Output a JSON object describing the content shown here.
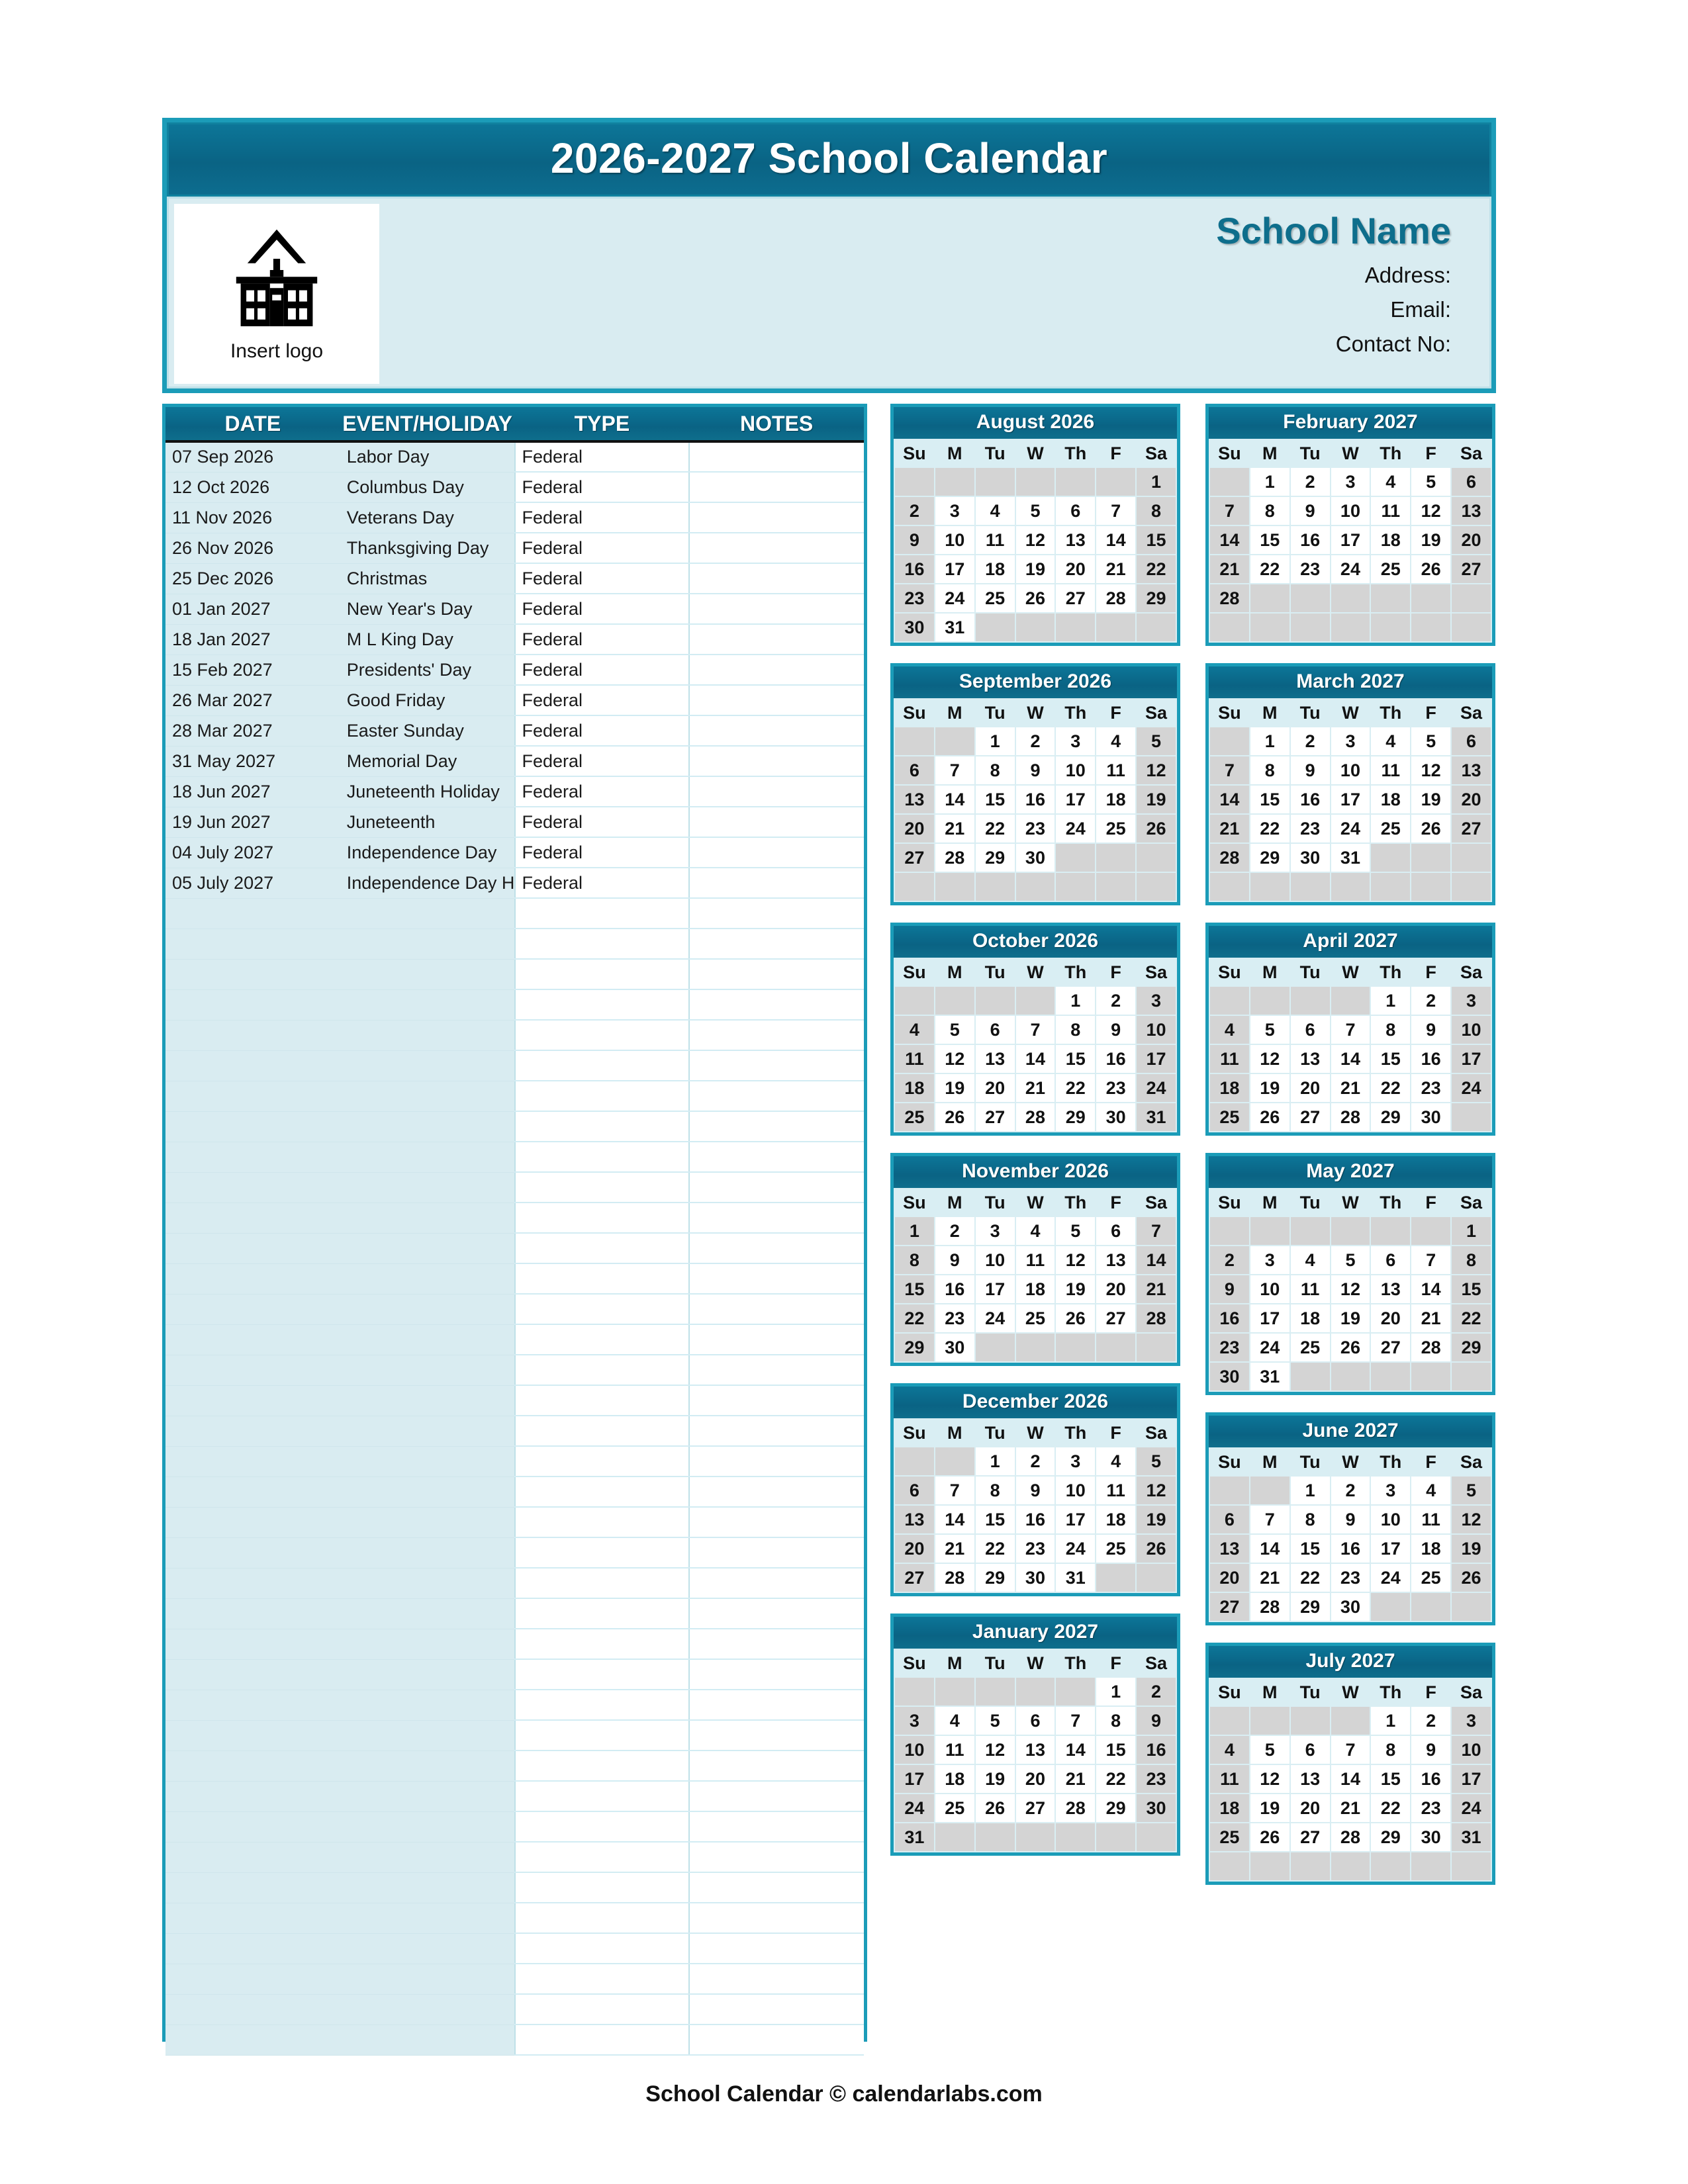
{
  "header": {
    "title": "2026-2027 School Calendar",
    "logo_caption": "Insert logo",
    "school_name": "School Name",
    "address_label": "Address:",
    "email_label": "Email:",
    "contact_label": "Contact No:"
  },
  "events_table": {
    "columns": [
      "DATE",
      "EVENT/HOLIDAY",
      "TYPE",
      "NOTES"
    ],
    "rows": [
      {
        "date": "07 Sep 2026",
        "event": "Labor Day",
        "type": "Federal",
        "notes": ""
      },
      {
        "date": "12 Oct 2026",
        "event": "Columbus Day",
        "type": "Federal",
        "notes": ""
      },
      {
        "date": "11 Nov 2026",
        "event": "Veterans Day",
        "type": "Federal",
        "notes": ""
      },
      {
        "date": "26 Nov 2026",
        "event": "Thanksgiving Day",
        "type": "Federal",
        "notes": ""
      },
      {
        "date": "25 Dec 2026",
        "event": "Christmas",
        "type": "Federal",
        "notes": ""
      },
      {
        "date": "01 Jan 2027",
        "event": "New Year's Day",
        "type": "Federal",
        "notes": ""
      },
      {
        "date": "18 Jan 2027",
        "event": "M L King Day",
        "type": "Federal",
        "notes": ""
      },
      {
        "date": "15 Feb 2027",
        "event": "Presidents' Day",
        "type": "Federal",
        "notes": ""
      },
      {
        "date": "26 Mar 2027",
        "event": "Good Friday",
        "type": "Federal",
        "notes": ""
      },
      {
        "date": "28 Mar 2027",
        "event": "Easter Sunday",
        "type": "Federal",
        "notes": ""
      },
      {
        "date": "31 May 2027",
        "event": "Memorial Day",
        "type": "Federal",
        "notes": ""
      },
      {
        "date": "18 Jun 2027",
        "event": "Juneteenth Holiday",
        "type": "Federal",
        "notes": ""
      },
      {
        "date": "19 Jun 2027",
        "event": "Juneteenth",
        "type": "Federal",
        "notes": ""
      },
      {
        "date": "04 July 2027",
        "event": "Independence Day",
        "type": "Federal",
        "notes": ""
      },
      {
        "date": "05 July 2027",
        "event": "Independence Day H",
        "type": "Federal",
        "notes": ""
      }
    ],
    "empty_rows": 38
  },
  "calendar": {
    "weekday_headers": [
      "Su",
      "M",
      "Tu",
      "W",
      "Th",
      "F",
      "Sa"
    ],
    "left_column": [
      {
        "title": "August 2026",
        "first_weekday": 6,
        "days": 31,
        "weeks": 6
      },
      {
        "title": "September 2026",
        "first_weekday": 2,
        "days": 30,
        "weeks": 6
      },
      {
        "title": "October 2026",
        "first_weekday": 4,
        "days": 31,
        "weeks": 5
      },
      {
        "title": "November 2026",
        "first_weekday": 0,
        "days": 30,
        "weeks": 5
      },
      {
        "title": "December 2026",
        "first_weekday": 2,
        "days": 31,
        "weeks": 5
      },
      {
        "title": "January 2027",
        "first_weekday": 5,
        "days": 31,
        "weeks": 6
      }
    ],
    "right_column": [
      {
        "title": "February 2027",
        "first_weekday": 1,
        "days": 28,
        "weeks": 6
      },
      {
        "title": "March 2027",
        "first_weekday": 1,
        "days": 31,
        "weeks": 6
      },
      {
        "title": "April 2027",
        "first_weekday": 4,
        "days": 30,
        "weeks": 5
      },
      {
        "title": "May 2027",
        "first_weekday": 6,
        "days": 31,
        "weeks": 6
      },
      {
        "title": "June 2027",
        "first_weekday": 2,
        "days": 30,
        "weeks": 5
      },
      {
        "title": "July 2027",
        "first_weekday": 4,
        "days": 31,
        "weeks": 6
      }
    ]
  },
  "footer": {
    "text": "School Calendar © calendarlabs.com"
  },
  "colors": {
    "accent_dark": "#0e6e8c",
    "accent_border": "#1b9cb8",
    "panel_bg": "#d9ecf1",
    "weekend_bg": "#d4d4d4",
    "weekday_bg": "#ffffff"
  }
}
